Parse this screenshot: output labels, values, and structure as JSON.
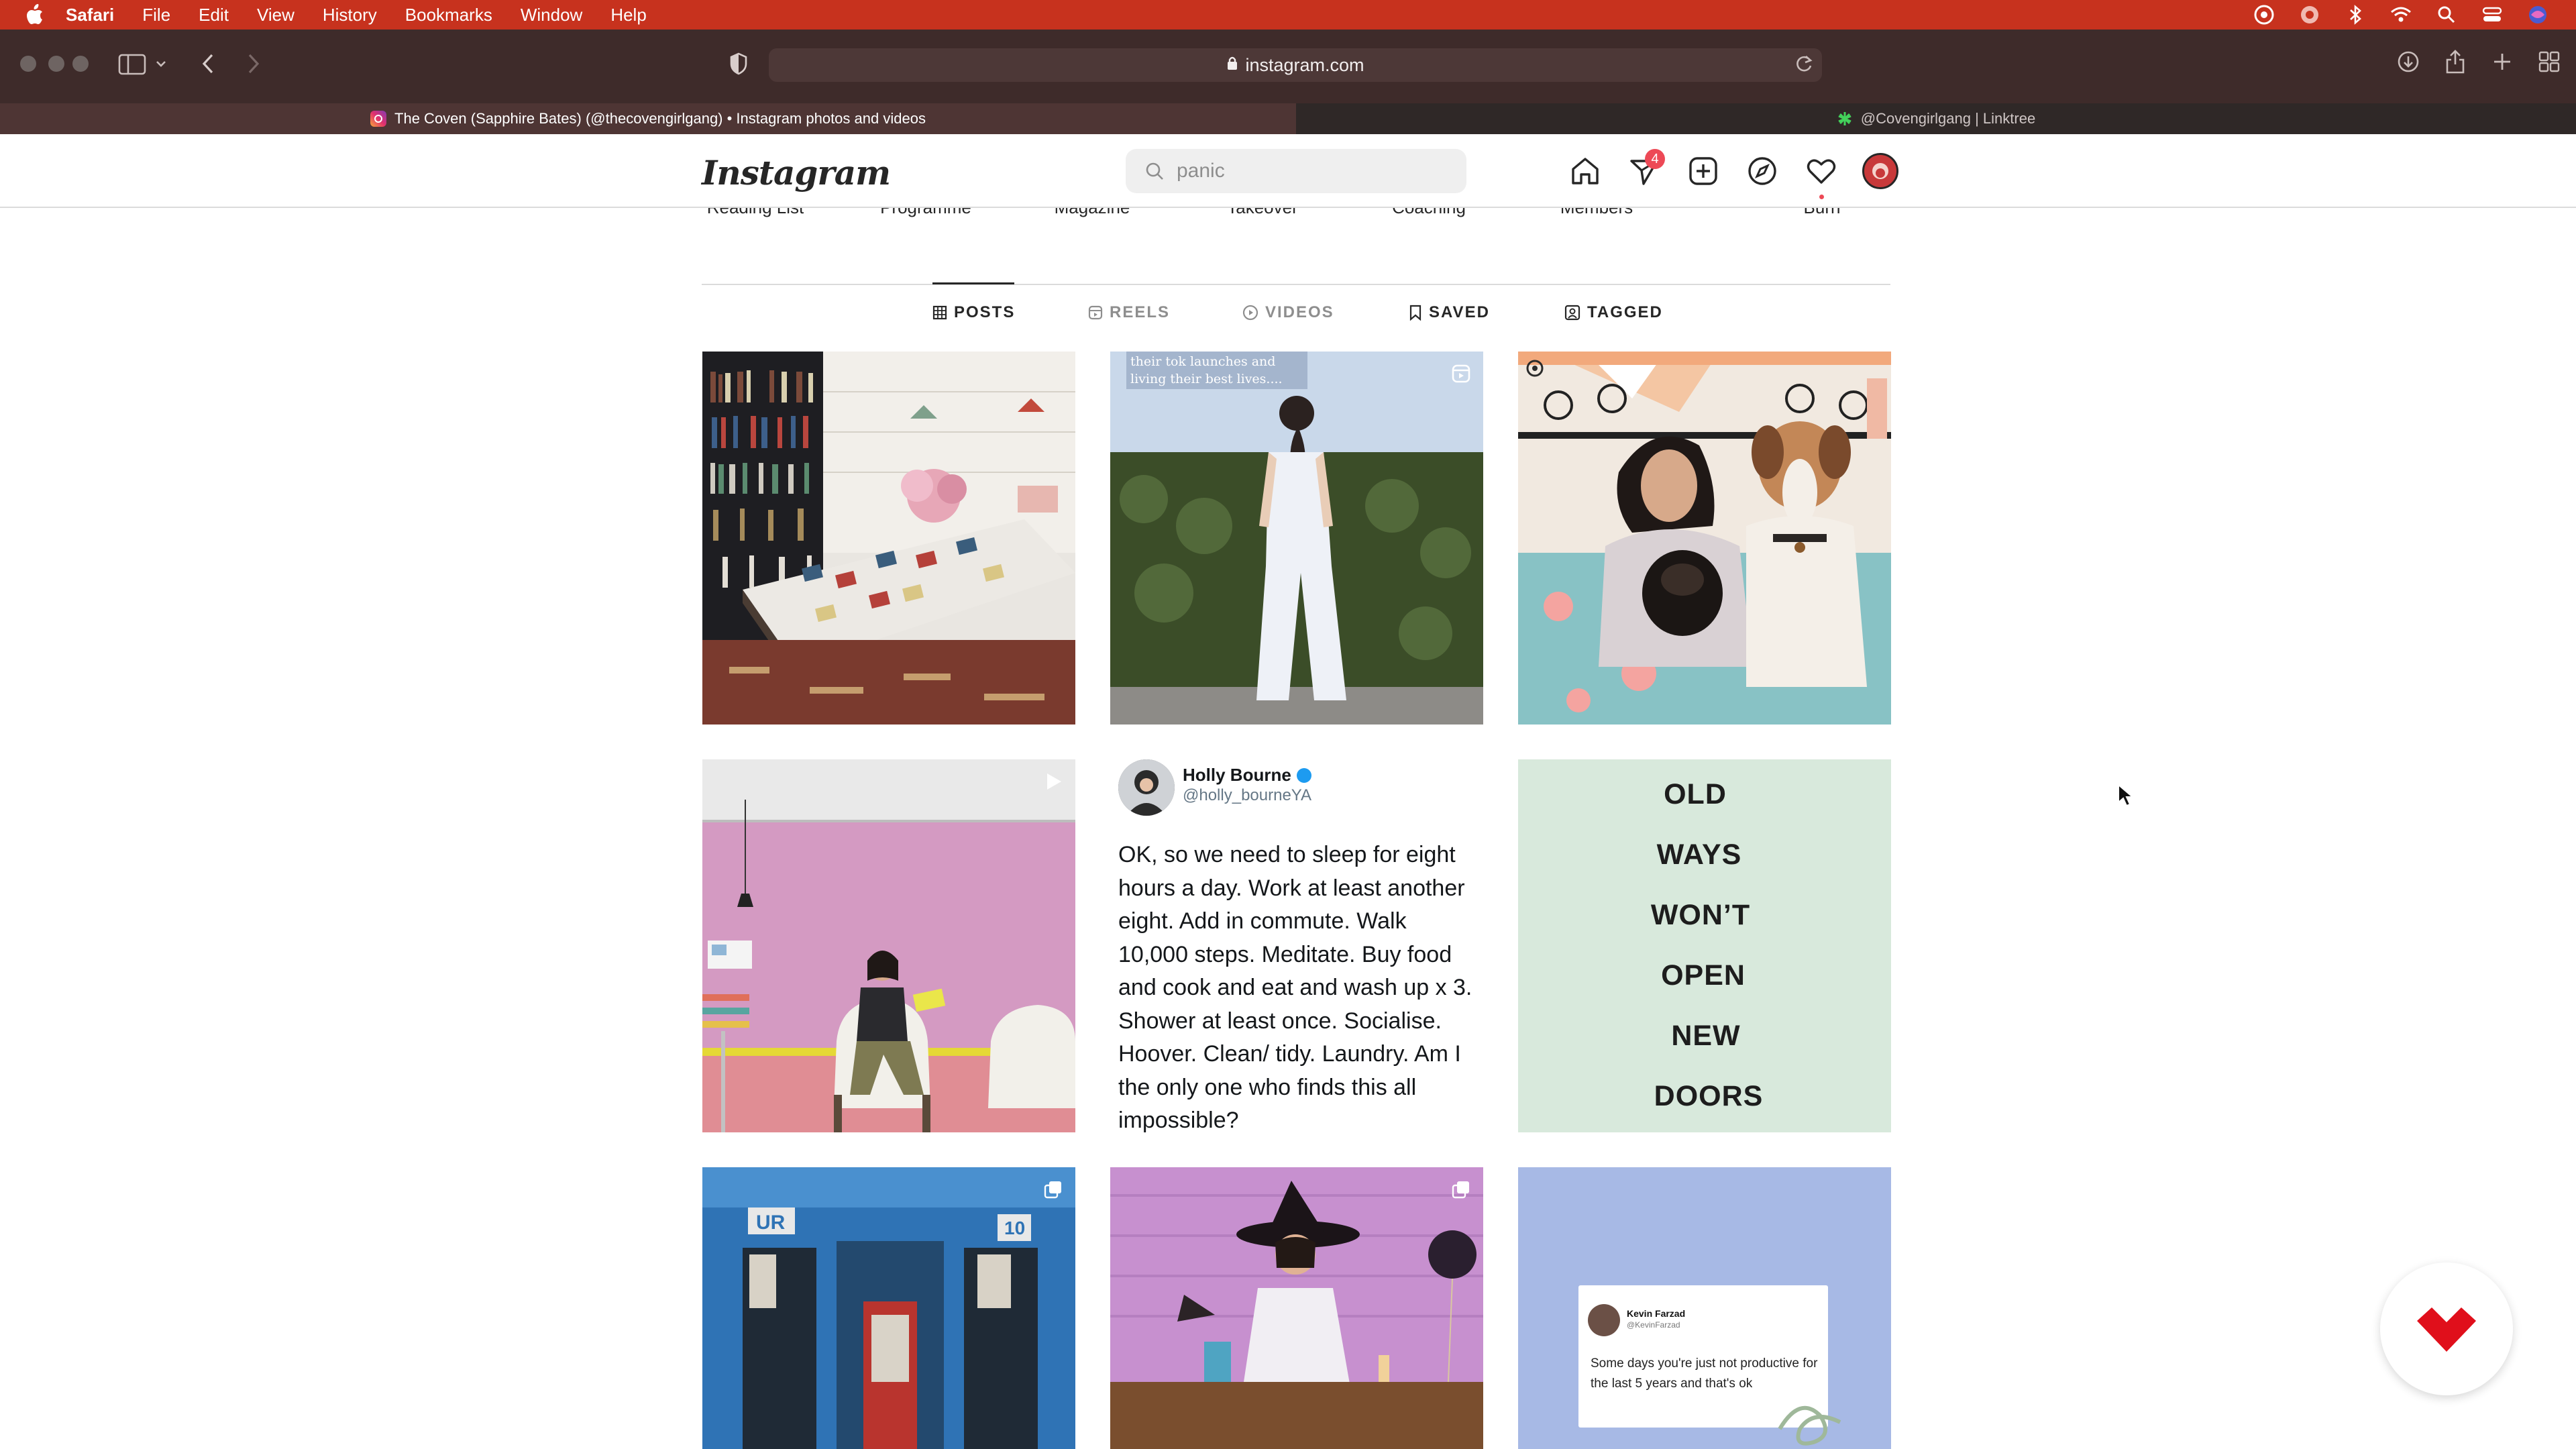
{
  "menubar": {
    "app_name": "Safari",
    "items": [
      "File",
      "Edit",
      "View",
      "History",
      "Bookmarks",
      "Window",
      "Help"
    ],
    "status_icons": [
      "creative-cloud-icon",
      "vpn-icon",
      "bluetooth-icon",
      "wifi-icon",
      "spotlight-icon",
      "control-center-icon",
      "siri-icon"
    ]
  },
  "browser": {
    "url": "instagram.com",
    "tabs": [
      {
        "title": "The Coven (Sapphire Bates) (@thecovengirlgang) • Instagram photos and videos",
        "active": true,
        "favicon": "instagram-icon"
      },
      {
        "title": "@Covengirlgang | Linktree",
        "active": false,
        "favicon": "linktree-icon"
      }
    ]
  },
  "instagram": {
    "logo": "Instagram",
    "search": {
      "value": "panic",
      "placeholder": "Search"
    },
    "notification_count": "4",
    "highlights_partial": [
      "Reading List",
      "Programme",
      "Magazine",
      "Takeover",
      "Coaching",
      "Members",
      "Burn"
    ],
    "profile_tabs": [
      {
        "label": "POSTS",
        "icon": "grid-icon",
        "active": true
      },
      {
        "label": "REELS",
        "icon": "reels-icon",
        "active": false
      },
      {
        "label": "VIDEOS",
        "icon": "video-icon",
        "active": false
      },
      {
        "label": "SAVED",
        "icon": "bookmark-icon",
        "active": false
      },
      {
        "label": "TAGGED",
        "icon": "tag-icon",
        "active": false
      }
    ],
    "posts": {
      "p2_caption": "their tok launches and living their best lives....",
      "tweet": {
        "name": "Holly Bourne",
        "handle": "@holly_bourneYA",
        "text": "OK, so we need to sleep for eight hours a day. Work at least another eight. Add in commute. Walk 10,000 steps. Meditate. Buy food and cook and eat and wash up x 3. Shower at least once. Socialise. Hoover. Clean/ tidy. Laundry. Am I the only one who finds this all impossible?"
      },
      "quote_words": [
        "OLD",
        "WAYS",
        "WON’T",
        "OPEN",
        "NEW",
        "DOORS"
      ],
      "kevin": {
        "name": "Kevin Farzad",
        "handle": "@KevinFarzad",
        "text": "Some days you're just not productive for the last 5 years and that's ok"
      }
    }
  },
  "colors": {
    "menubar": "#c7321e",
    "toolbar": "#3e2b2a",
    "badge": "#ed4956",
    "quote_bg": "#d8e9dc",
    "kevin_bg": "#a7b9e5"
  }
}
